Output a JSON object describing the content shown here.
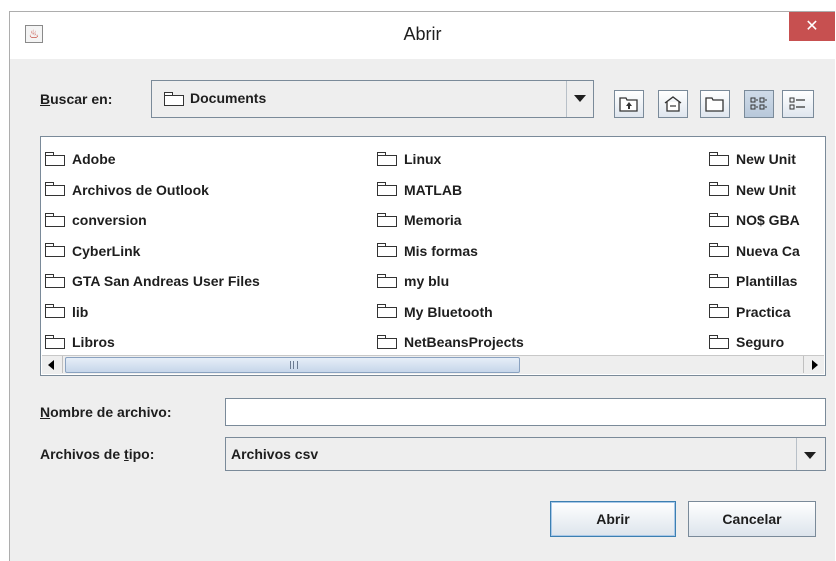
{
  "window": {
    "title": "Abrir",
    "close_glyph": "✕"
  },
  "look_in": {
    "label_mnemonic": "B",
    "label_rest": "uscar en:",
    "value": "Documents"
  },
  "toolbar": {
    "buttons": [
      {
        "name": "up-one-level-icon",
        "selected": false
      },
      {
        "name": "home-icon",
        "selected": false
      },
      {
        "name": "new-folder-icon",
        "selected": false
      },
      {
        "name": "list-view-icon",
        "selected": true
      },
      {
        "name": "details-view-icon",
        "selected": false
      }
    ]
  },
  "files": {
    "columns": [
      [
        "Adobe",
        "Archivos de Outlook",
        "conversion",
        "CyberLink",
        "GTA San Andreas User Files",
        "lib",
        "Libros"
      ],
      [
        "Linux",
        "MATLAB",
        "Memoria",
        "Mis formas",
        "my blu",
        "My Bluetooth",
        "NetBeansProjects"
      ],
      [
        "New Unit",
        "New Unit",
        "NO$ GBA",
        "Nueva Ca",
        "Plantillas",
        "Practica",
        "Seguro"
      ]
    ]
  },
  "filename": {
    "label_mnemonic": "N",
    "label_rest": "ombre de archivo:",
    "value": ""
  },
  "filetype": {
    "label_pre": "Archivos de ",
    "label_mnemonic": "t",
    "label_rest": "ipo:",
    "value": "Archivos csv"
  },
  "buttons": {
    "open_label": "Abrir",
    "cancel_label": "Cancelar"
  }
}
